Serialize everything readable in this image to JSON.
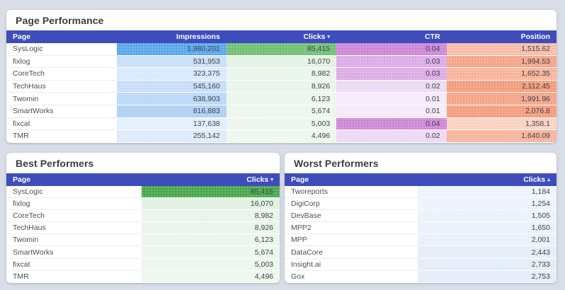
{
  "theme": {
    "page_bg": "#d8dde7",
    "card_bg": "#ffffff",
    "table_header_bg": "#3e4dbb",
    "table_header_text": "#ffffff",
    "title_color": "#3b3e45",
    "heat_blue_max": "#5aa7ee",
    "heat_green_max": "#49a84e",
    "heat_purple_max": "#cd87d8",
    "heat_orange_max": "#f49c7c"
  },
  "page_performance": {
    "title": "Page Performance",
    "headers": {
      "page": "Page",
      "impressions": "Impressions",
      "clicks": "Clicks",
      "ctr": "CTR",
      "position": "Position"
    },
    "clicks_sort_icon": "▾",
    "rows": [
      {
        "page": "SysLogic",
        "impressions": "1,980,201",
        "clicks": "85,415",
        "ctr": "0.04",
        "position": "1,515.62",
        "impressions_bg": "#5aa7ee",
        "clicks_bg": "#72c076",
        "ctr_bg": "#cd87d8",
        "position_bg": "#f8bda7"
      },
      {
        "page": "fixlog",
        "impressions": "531,953",
        "clicks": "16,070",
        "ctr": "0.03",
        "position": "1,994.53",
        "impressions_bg": "#c8dff9",
        "clicks_bg": "#e2f2e3",
        "ctr_bg": "#dcabe6",
        "position_bg": "#f5a487"
      },
      {
        "page": "CoreTech",
        "impressions": "323,375",
        "clicks": "8,982",
        "ctr": "0.03",
        "position": "1,652.35",
        "impressions_bg": "#d9e9fc",
        "clicks_bg": "#e9f5ea",
        "ctr_bg": "#dcabe6",
        "position_bg": "#f7b49b"
      },
      {
        "page": "TechHaus",
        "impressions": "545,160",
        "clicks": "8,926",
        "ctr": "0.02",
        "position": "2,112.45",
        "impressions_bg": "#c6def9",
        "clicks_bg": "#e9f5ea",
        "ctr_bg": "#eed8f3",
        "position_bg": "#f49c7c"
      },
      {
        "page": "Twomin",
        "impressions": "638,903",
        "clicks": "6,123",
        "ctr": "0.01",
        "position": "1,991.96",
        "impressions_bg": "#bcd8f8",
        "clicks_bg": "#ebf6ec",
        "ctr_bg": "#f6e9f9",
        "position_bg": "#f5a488"
      },
      {
        "page": "SmartWorks",
        "impressions": "816,883",
        "clicks": "5,674",
        "ctr": "0.01",
        "position": "2,076.8",
        "impressions_bg": "#b0d0f5",
        "clicks_bg": "#ecf6ed",
        "ctr_bg": "#f6e9f9",
        "position_bg": "#f49e7f"
      },
      {
        "page": "fixcat",
        "impressions": "137,638",
        "clicks": "5,003",
        "ctr": "0.04",
        "position": "1,358.1",
        "impressions_bg": "#e4effd",
        "clicks_bg": "#ecf6ed",
        "ctr_bg": "#cd87d8",
        "position_bg": "#fbd2c1"
      },
      {
        "page": "TMR",
        "impressions": "255,142",
        "clicks": "4,496",
        "ctr": "0.02",
        "position": "1,640.09",
        "impressions_bg": "#dcebfc",
        "clicks_bg": "#edf7ee",
        "ctr_bg": "#eed8f3",
        "position_bg": "#f7b49c"
      }
    ]
  },
  "best_performers": {
    "title": "Best Performers",
    "headers": {
      "page": "Page",
      "clicks": "Clicks"
    },
    "clicks_sort_icon": "▾",
    "rows": [
      {
        "page": "SysLogic",
        "clicks": "85,415",
        "clicks_bg": "#49a84e"
      },
      {
        "page": "fixlog",
        "clicks": "16,070",
        "clicks_bg": "#e0f1e1"
      },
      {
        "page": "CoreTech",
        "clicks": "8,982",
        "clicks_bg": "#e8f4e9"
      },
      {
        "page": "TechHaus",
        "clicks": "8,926",
        "clicks_bg": "#e8f4e9"
      },
      {
        "page": "Twomin",
        "clicks": "6,123",
        "clicks_bg": "#eaf5eb"
      },
      {
        "page": "SmartWorks",
        "clicks": "5,674",
        "clicks_bg": "#ebf6ec"
      },
      {
        "page": "fixcat",
        "clicks": "5,003",
        "clicks_bg": "#ebf6ec"
      },
      {
        "page": "TMR",
        "clicks": "4,496",
        "clicks_bg": "#ecf7ed"
      }
    ]
  },
  "worst_performers": {
    "title": "Worst Performers",
    "headers": {
      "page": "Page",
      "clicks": "Clicks"
    },
    "clicks_sort_icon": "▴",
    "rows": [
      {
        "page": "Tworeports",
        "clicks": "1,184",
        "clicks_bg": "#eef4fc"
      },
      {
        "page": "DigiCorp",
        "clicks": "1,254",
        "clicks_bg": "#edf3fc"
      },
      {
        "page": "DevBase",
        "clicks": "1,505",
        "clicks_bg": "#ebf2fb"
      },
      {
        "page": "MPP2",
        "clicks": "1,650",
        "clicks_bg": "#eaf1fb"
      },
      {
        "page": "MPP",
        "clicks": "2,001",
        "clicks_bg": "#e8f0fa"
      },
      {
        "page": "DataCore",
        "clicks": "2,443",
        "clicks_bg": "#e5edfa"
      },
      {
        "page": "Insight.ai",
        "clicks": "2,733",
        "clicks_bg": "#e3ecf9"
      },
      {
        "page": "Gox",
        "clicks": "2,753",
        "clicks_bg": "#e3ecf9"
      }
    ]
  }
}
